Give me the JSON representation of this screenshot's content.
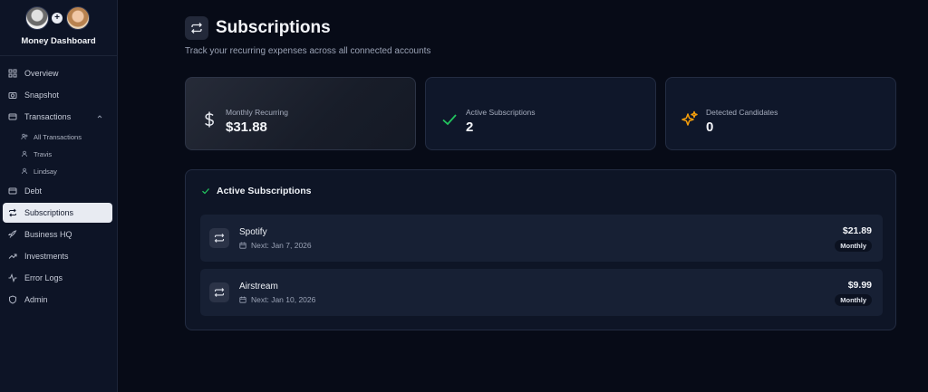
{
  "app": {
    "brand_name": "Money Dashboard"
  },
  "sidebar": {
    "items": [
      {
        "label": "Overview",
        "icon": "grid-icon"
      },
      {
        "label": "Snapshot",
        "icon": "camera-icon"
      },
      {
        "label": "Transactions",
        "icon": "card-icon",
        "expanded": true
      },
      {
        "label": "Debt",
        "icon": "card-icon"
      },
      {
        "label": "Subscriptions",
        "icon": "repeat-icon",
        "active": true
      },
      {
        "label": "Business HQ",
        "icon": "rocket-icon"
      },
      {
        "label": "Investments",
        "icon": "trending-up-icon"
      },
      {
        "label": "Error Logs",
        "icon": "activity-icon"
      },
      {
        "label": "Admin",
        "icon": "shield-icon"
      }
    ],
    "transactions_sub": [
      {
        "label": "All Transactions",
        "icon": "users-icon"
      },
      {
        "label": "Travis",
        "icon": "user-icon"
      },
      {
        "label": "Lindsay",
        "icon": "user-icon"
      }
    ]
  },
  "header": {
    "title": "Subscriptions",
    "subtitle": "Track your recurring expenses across all connected accounts"
  },
  "stats": [
    {
      "label": "Monthly Recurring",
      "value": "$31.88",
      "icon": "dollar-icon"
    },
    {
      "label": "Active Subscriptions",
      "value": "2",
      "icon": "check-icon"
    },
    {
      "label": "Detected Candidates",
      "value": "0",
      "icon": "sparkles-icon"
    }
  ],
  "active_panel": {
    "title": "Active Subscriptions",
    "rows": [
      {
        "name": "Spotify",
        "next": "Next: Jan 7, 2026",
        "amount": "$21.89",
        "frequency": "Monthly"
      },
      {
        "name": "Airstream",
        "next": "Next: Jan 10, 2026",
        "amount": "$9.99",
        "frequency": "Monthly"
      }
    ]
  },
  "colors": {
    "background": "#070b17",
    "sidebar": "#0d1426",
    "accent_green": "#22c55e",
    "accent_amber": "#f59e0b",
    "active_nav": "#e8ebf2"
  }
}
